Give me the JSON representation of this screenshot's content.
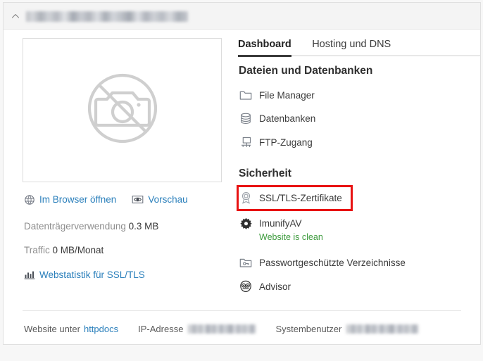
{
  "header": {
    "collapse_icon": "chevron-up-icon",
    "title_redacted": true,
    "title_text": ""
  },
  "left_panel": {
    "thumbnail": {
      "icon": "no-screenshot-camera-icon",
      "alt": ""
    },
    "links": [
      {
        "label": "Im Browser öffnen",
        "icon": "globe-icon"
      },
      {
        "label": "Vorschau",
        "icon": "eye-icon"
      }
    ],
    "stats": [
      {
        "label": "Datenträgerverwendung",
        "value": "0.3 MB"
      },
      {
        "label": "Traffic",
        "value": "0 MB/Monat"
      }
    ],
    "webstat_link": {
      "label": "Webstatistik für SSL/TLS",
      "icon": "bar-chart-icon"
    }
  },
  "tabs": [
    {
      "label": "Dashboard",
      "active": true
    },
    {
      "label": "Hosting und DNS",
      "active": false
    }
  ],
  "sections": {
    "files": {
      "title": "Dateien und Datenbanken",
      "items": [
        {
          "label": "File Manager",
          "icon": "folder-icon"
        },
        {
          "label": "Datenbanken",
          "icon": "database-icon"
        },
        {
          "label": "FTP-Zugang",
          "icon": "ftp-monitor-icon"
        }
      ]
    },
    "security": {
      "title": "Sicherheit",
      "items": [
        {
          "label": "SSL/TLS-Zertifikate",
          "icon": "certificate-rosette-icon",
          "highlighted": true
        },
        {
          "label": "ImunifyAV",
          "icon": "imunify-gear-icon",
          "status": "Website is clean"
        },
        {
          "label": "Passwortgeschützte Verzeichnisse",
          "icon": "folder-key-icon"
        },
        {
          "label": "Advisor",
          "icon": "advisor-owl-icon"
        }
      ]
    }
  },
  "footer": {
    "website_label": "Website unter",
    "website_value": "httpdocs",
    "ip_label": "IP-Adresse",
    "ip_value_redacted": true,
    "sysuser_label": "Systembenutzer",
    "sysuser_value_redacted": true
  },
  "colors": {
    "link": "#2a7fbb",
    "highlight": "#e81212",
    "status_ok": "#3c9a3c",
    "header_bg": "#f4f4f4",
    "card_border": "#e0e0e0"
  }
}
